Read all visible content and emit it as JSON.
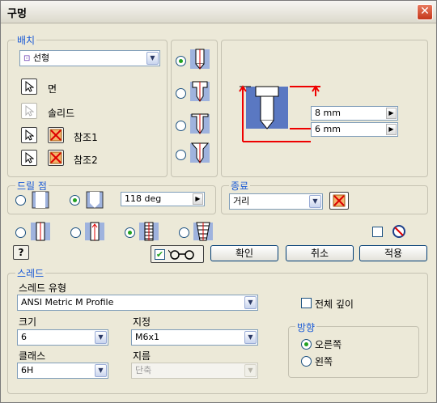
{
  "window": {
    "title": "구멍",
    "close_icon": "close-icon"
  },
  "placement": {
    "legend": "배치",
    "type_value": "선형",
    "face_label": "면",
    "solid_label": "솔리드",
    "ref1_label": "참조1",
    "ref2_label": "참조2"
  },
  "hole_types": [
    {
      "name": "drilled",
      "selected": true
    },
    {
      "name": "counterbore",
      "selected": false
    },
    {
      "name": "spotface",
      "selected": false
    },
    {
      "name": "countersink",
      "selected": false
    }
  ],
  "preview": {
    "dim1": "8 mm",
    "dim2": "6 mm"
  },
  "drill_point": {
    "legend": "드릴 점",
    "angle": "118 deg",
    "flat_selected": false,
    "angle_selected": true
  },
  "termination": {
    "legend": "종료",
    "value": "거리"
  },
  "tap_options": [
    {
      "name": "simple",
      "selected": false
    },
    {
      "name": "clearance",
      "selected": false
    },
    {
      "name": "tapped",
      "selected": true
    },
    {
      "name": "taper-tapped",
      "selected": false
    }
  ],
  "buttons": {
    "ok": "확인",
    "cancel": "취소",
    "apply": "적용"
  },
  "thread": {
    "legend": "스레드",
    "type_label": "스레드 유형",
    "type_value": "ANSI Metric M Profile",
    "size_label": "크기",
    "size_value": "6",
    "designation_label": "지정",
    "designation_value": "M6x1",
    "class_label": "클래스",
    "class_value": "6H",
    "diameter_label": "지름",
    "diameter_value": "단축",
    "full_depth_label": "전체 깊이",
    "full_depth_checked": false,
    "direction_legend": "방향",
    "right_label": "오른쪽",
    "left_label": "왼쪽",
    "right_selected": true
  },
  "colors": {
    "accent": "#1a5ad6",
    "dim_red": "#e00000",
    "hole_blue": "#3a5fb0"
  }
}
